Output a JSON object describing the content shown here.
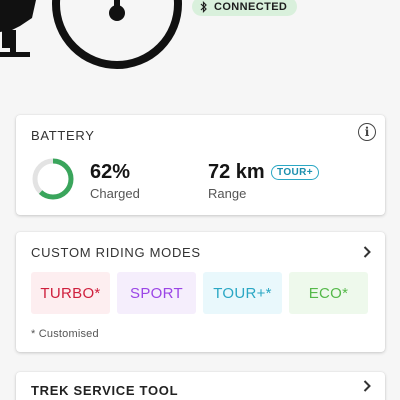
{
  "status": {
    "connected_label": "CONNECTED"
  },
  "battery": {
    "title": "BATTERY",
    "percent": 62,
    "percent_label": "62%",
    "charged_label": "Charged",
    "range_value": "72 km",
    "range_label": "Range",
    "mode_tag": "TOUR+"
  },
  "riding_modes": {
    "title": "CUSTOM RIDING MODES",
    "modes": [
      {
        "label": "TURBO*"
      },
      {
        "label": "SPORT"
      },
      {
        "label": "TOUR+*"
      },
      {
        "label": "ECO*"
      }
    ],
    "footnote": "* Customised"
  },
  "service_tool": {
    "title": "TREK SERVICE TOOL"
  },
  "icons": {
    "info": "info-icon",
    "chevron": "chevron-right-icon",
    "bluetooth": "bluetooth-icon"
  },
  "colors": {
    "battery_ring": "#3aa55c",
    "turbo": "#cf1f3d",
    "sport": "#9b45e6",
    "tour": "#2aa7c4",
    "eco": "#55b94a",
    "connected_bg": "#d9f0dc"
  }
}
